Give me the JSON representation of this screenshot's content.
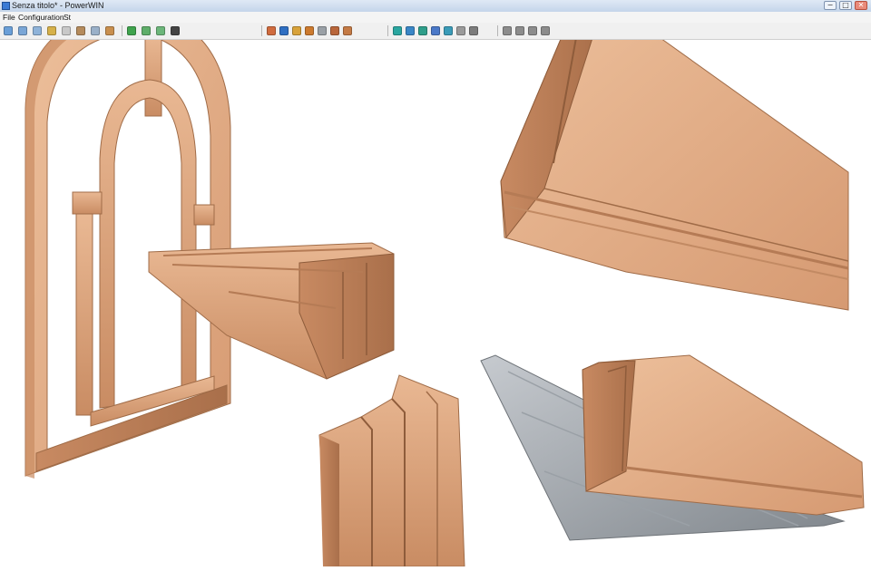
{
  "window": {
    "title": "Senza titolo* - PowerWIN",
    "controls": {
      "minimize": "−",
      "maximize": "□",
      "close": "✕"
    }
  },
  "menu": {
    "items": [
      "File",
      "Configuration",
      "St"
    ]
  },
  "toolbar": {
    "icons": [
      {
        "name": "open-icon",
        "color": "#6a9fd8"
      },
      {
        "name": "save-icon",
        "color": "#7aa6d6"
      },
      {
        "name": "print-icon",
        "color": "#8fb3d9"
      },
      {
        "name": "tool-icon",
        "color": "#d6b14a"
      },
      {
        "name": "shape-icon",
        "color": "#c8c8c8"
      },
      {
        "name": "frame-icon",
        "color": "#b58b5c"
      },
      {
        "name": "grid-icon",
        "color": "#9ab0c8"
      },
      {
        "name": "material-icon",
        "color": "#c98f4e"
      },
      {
        "name": "shield-icon",
        "color": "#3fa34d"
      },
      {
        "name": "view3d-icon",
        "color": "#5fae6a"
      },
      {
        "name": "view3d-alt-icon",
        "color": "#6cb67a"
      },
      {
        "name": "lock-icon",
        "color": "#444444"
      },
      {
        "name": "parts-icon",
        "color": "#d06b3e"
      },
      {
        "name": "target-icon",
        "color": "#2f6fc2"
      },
      {
        "name": "bolt-icon",
        "color": "#d8a23a"
      },
      {
        "name": "report-icon",
        "color": "#cc7a2e"
      },
      {
        "name": "list-icon",
        "color": "#9aa0a6"
      },
      {
        "name": "image-icon",
        "color": "#b9663b"
      },
      {
        "name": "image-alt-icon",
        "color": "#c47a45"
      },
      {
        "name": "cube-front-icon",
        "color": "#2aa6a0"
      },
      {
        "name": "cube-top-icon",
        "color": "#3a86c6"
      },
      {
        "name": "cube-side-icon",
        "color": "#2f9e8a"
      },
      {
        "name": "cube-iso-icon",
        "color": "#4a78c8"
      },
      {
        "name": "cube-back-icon",
        "color": "#3a9bb8"
      },
      {
        "name": "cube-grey-icon",
        "color": "#9a9a9a"
      },
      {
        "name": "cube-wire-icon",
        "color": "#7c7c7c"
      },
      {
        "name": "align-left-icon",
        "color": "#8c8c8c"
      },
      {
        "name": "align-center-icon",
        "color": "#8c8c8c"
      },
      {
        "name": "align-right-icon",
        "color": "#8c8c8c"
      },
      {
        "name": "align-bottom-icon",
        "color": "#8c8c8c"
      }
    ]
  },
  "scene": {
    "wood_light": "#e7b48f",
    "wood_mid": "#d79c75",
    "wood_dark": "#b97d57",
    "metal_light": "#b9bec3",
    "metal_dark": "#7f858b"
  }
}
